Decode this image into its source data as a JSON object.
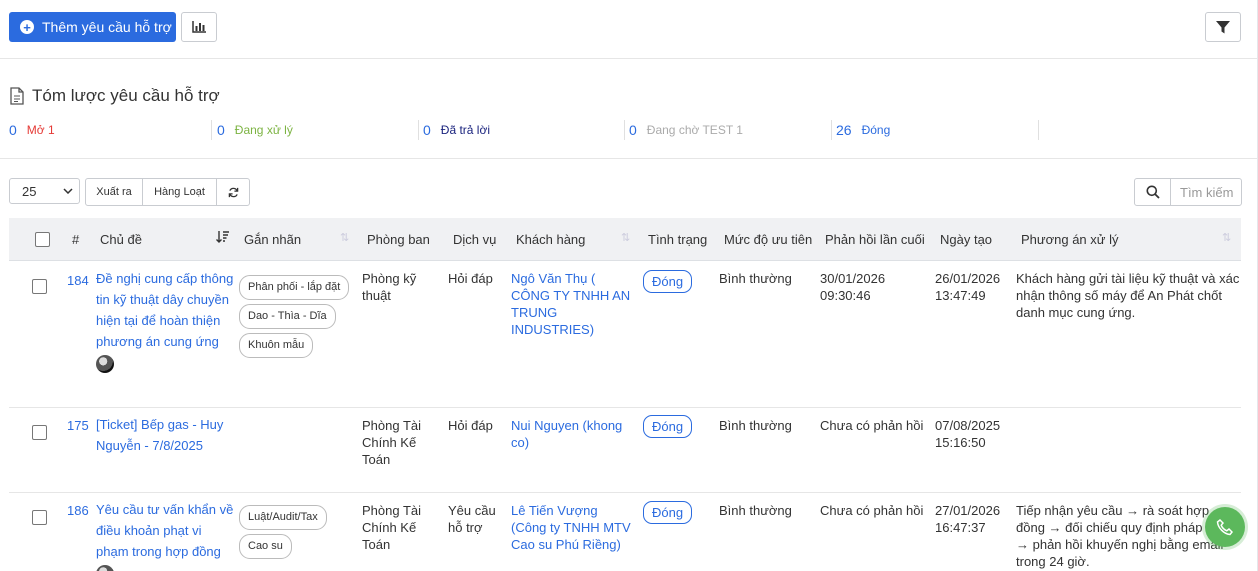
{
  "toolbar": {
    "add_label": "Thêm yêu cầu hỗ trợ"
  },
  "summary": {
    "title": "Tóm lược yêu cầu hỗ trợ",
    "stats": [
      {
        "count": "0",
        "label": "Mở 1",
        "color": "#e53935"
      },
      {
        "count": "0",
        "label": "Đang xử lý",
        "color": "#7cb342"
      },
      {
        "count": "0",
        "label": "Đã trả lời",
        "color": "#1a237e"
      },
      {
        "count": "0",
        "label": "Đang chờ TEST 1",
        "color": "#aaaaaa"
      },
      {
        "count": "26",
        "label": "Đóng",
        "color": "#2b6bdf"
      }
    ]
  },
  "controls": {
    "page_size": "25",
    "export_label": "Xuất ra",
    "bulk_label": "Hàng Loạt",
    "search_placeholder": "Tìm kiếm"
  },
  "table": {
    "headers": {
      "num": "#",
      "subject": "Chủ đề",
      "tags": "Gắn nhãn",
      "department": "Phòng ban",
      "service": "Dịch vụ",
      "customer": "Khách hàng",
      "status": "Tình trạng",
      "priority": "Mức độ ưu tiên",
      "last_reply": "Phản hồi lần cuối",
      "created": "Ngày tạo",
      "solution": "Phương án xử lý"
    },
    "rows": [
      {
        "id": "184",
        "subject": "Đề nghị cung cấp thông tin kỹ thuật dây chuyền hiện tại để hoàn thiện phương án cung ứng",
        "tags": [
          "Phân phối - lắp đặt",
          "Dao - Thìa - Dĩa",
          "Khuôn mẫu"
        ],
        "department": "Phòng kỹ thuật",
        "service": "Hỏi đáp",
        "customer": "Ngô Văn Thụ ( CÔNG TY TNHH AN TRUNG INDUSTRIES)",
        "status": "Đóng",
        "priority": "Bình thường",
        "last_reply": "30/01/2026 09:30:46",
        "created": "26/01/2026 13:47:49",
        "solution": "Khách hàng gửi tài liệu kỹ thuật và xác nhận thông số máy để An Phát chốt danh mục cung ứng."
      },
      {
        "id": "175",
        "subject": "[Ticket] Bếp gas - Huy Nguyễn - 7/8/2025",
        "tags": [],
        "department": "Phòng Tài Chính Kế Toán",
        "service": "Hỏi đáp",
        "customer": "Nui Nguyen (khong co)",
        "status": "Đóng",
        "priority": "Bình thường",
        "last_reply": "Chưa có phản hồi",
        "created": "07/08/2025 15:16:50",
        "solution": ""
      },
      {
        "id": "186",
        "subject": "Yêu cầu tư vấn khẩn về điều khoản phạt vi phạm trong hợp đồng",
        "tags": [
          "Luật/Audit/Tax",
          "Cao su"
        ],
        "department": "Phòng Tài Chính Kế Toán",
        "service": "Yêu cầu hỗ trợ",
        "customer": "Lê Tiến Vượng (Công ty TNHH MTV Cao su Phú Riềng)",
        "status": "Đóng",
        "priority": "Bình thường",
        "last_reply": "Chưa có phản hồi",
        "created": "27/01/2026 16:47:37",
        "solution": "Tiếp nhận yêu cầu → rà soát hợp đồng → đối chiếu quy định pháp luật → phản hồi khuyến nghị bằng email trong 24 giờ."
      }
    ]
  }
}
